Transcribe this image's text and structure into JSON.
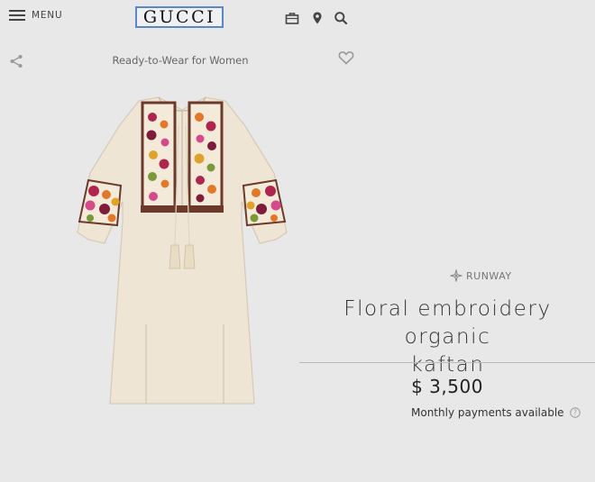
{
  "header": {
    "menu_label": "MENU",
    "logo": "GUCCI",
    "icons": [
      "hamburger-icon",
      "shopping-bag-icon",
      "location-pin-icon",
      "search-icon"
    ]
  },
  "product_nav": {
    "breadcrumb": "Ready-to-Wear for Women",
    "icons": [
      "share-icon",
      "heart-icon"
    ]
  },
  "product": {
    "image_alt": "Floral embroidery organic kaftan",
    "runway_label": "RUNWAY",
    "title_line1": "Floral embroidery organic",
    "title_line2": "kaftan",
    "price": "$ 3,500",
    "monthly_payments": "Monthly payments available"
  },
  "colors": {
    "background": "#e8e8e8",
    "logo_outline": "#5b86c9",
    "dress_fabric": "#efe5d4"
  }
}
